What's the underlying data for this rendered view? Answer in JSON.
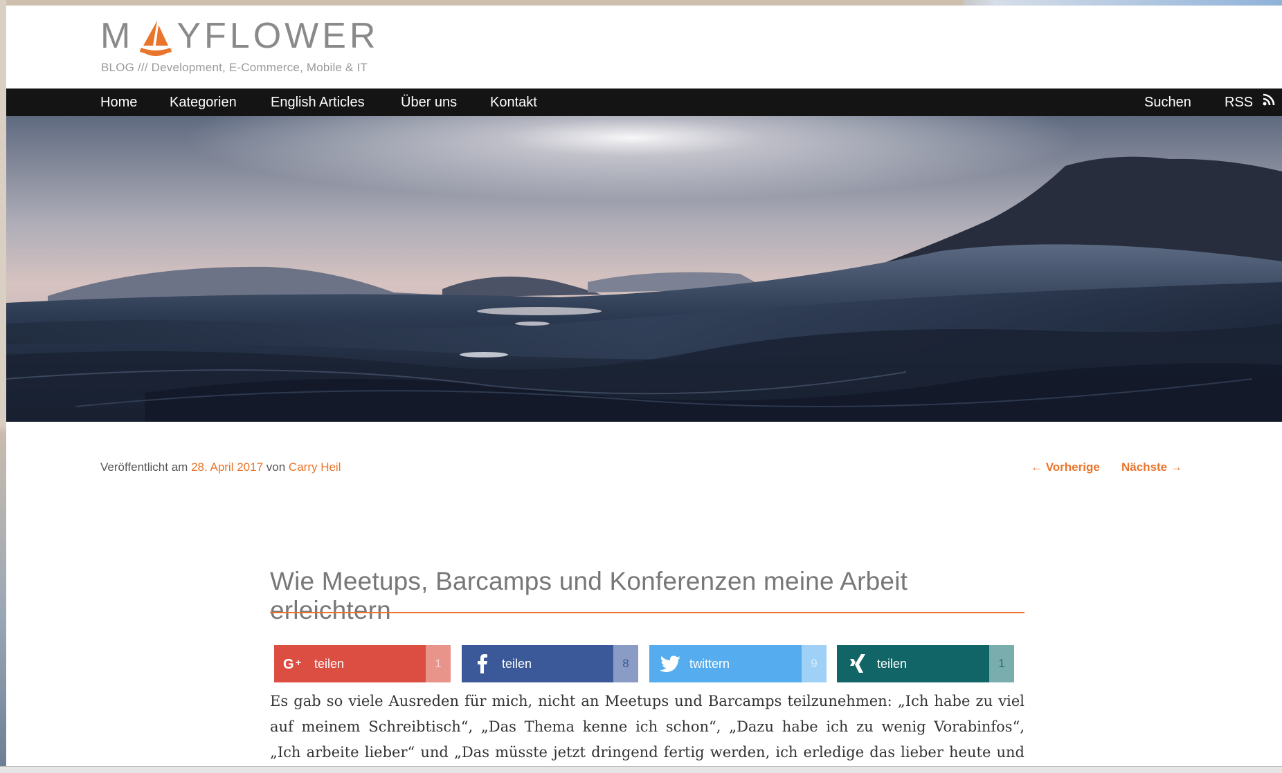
{
  "site": {
    "logo_left": "M",
    "logo_right": "YFLOWER",
    "tagline": "BLOG /// Development, E-Commerce, Mobile & IT",
    "brand_color": "#e9742b"
  },
  "nav": {
    "items": [
      "Home",
      "Kategorien",
      "English Articles",
      "Über uns",
      "Kontakt"
    ],
    "search": "Suchen",
    "rss": "RSS"
  },
  "post": {
    "published_prefix": "Veröffentlicht am",
    "date": "28. April 2017",
    "by": "von",
    "author": "Carry Heil",
    "prev": "← Vorherige",
    "next": "Nächste →",
    "title": "Wie Meetups, Barcamps und Konferenzen meine Arbeit erleichtern",
    "body_lines": [
      "Es gab so viele Ausreden für mich, nicht an Meetups und Barcamps teilzunehmen: „Ich habe zu viel",
      "auf meinem Schreibtisch“, „Das Thema kenne ich schon“, „Dazu habe ich zu wenig Vorabinfos“,",
      "„Ich arbeite lieber“ und „Das müsste jetzt dringend fertig werden, ich erledige das  lieber heute und"
    ]
  },
  "share": [
    {
      "network": "google-plus",
      "icon": "google-plus-icon",
      "label": "teilen",
      "count": "1",
      "color": "#dc4e41",
      "count_bg": "#e8948a"
    },
    {
      "network": "facebook",
      "icon": "facebook-icon",
      "label": "teilen",
      "count": "8",
      "color": "#3b5998",
      "count_bg": "#8a9cc5"
    },
    {
      "network": "twitter",
      "icon": "twitter-icon",
      "label": "twittern",
      "count": "9",
      "color": "#55acee",
      "count_bg": "#9fd0f5"
    },
    {
      "network": "xing",
      "icon": "xing-icon",
      "label": "teilen",
      "count": "1",
      "color": "#126567",
      "count_bg": "#7aaeae"
    }
  ]
}
